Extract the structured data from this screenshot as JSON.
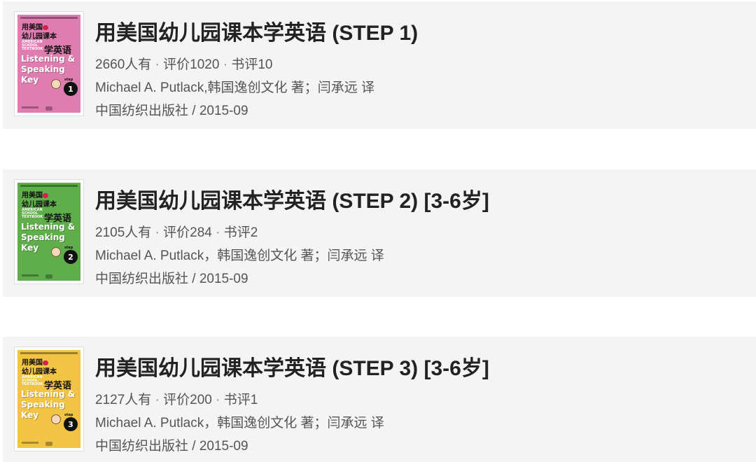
{
  "books": [
    {
      "title": "用美国幼儿园课本学英语 (STEP 1)",
      "owners": "2660人有",
      "ratings": "评价1020",
      "reviews": "书评10",
      "separator": " · ",
      "authors": "Michael A. Putlack,韩国逸创文化 著；闫承远 译",
      "publisher": "中国纺织出版社 / 2015-09",
      "cover": {
        "color": "#e07db0",
        "title_line1": "用美国",
        "title_line2": "幼儿园课本",
        "subtitle": "学英语",
        "school_text": "AMERICAN SCHOOL TEXTBOOK",
        "series_name": "Listening &\nSpeaking\nKey",
        "step_label": "step",
        "step_number": "1"
      }
    },
    {
      "title": "用美国幼儿园课本学英语 (STEP 2) [3-6岁]",
      "owners": "2105人有",
      "ratings": "评价284",
      "reviews": "书评2",
      "separator": " · ",
      "authors": "Michael A. Putlack，韩国逸创文化 著；闫承远 译",
      "publisher": "中国纺织出版社 / 2015-09",
      "cover": {
        "color": "#5fae4b",
        "title_line1": "用美国",
        "title_line2": "幼儿园课本",
        "subtitle": "学英语",
        "school_text": "AMERICAN SCHOOL TEXTBOOK",
        "series_name": "Listening &\nSpeaking\nKey",
        "step_label": "step",
        "step_number": "2"
      }
    },
    {
      "title": "用美国幼儿园课本学英语 (STEP 3) [3-6岁]",
      "owners": "2127人有",
      "ratings": "评价200",
      "reviews": "书评1",
      "separator": " · ",
      "authors": "Michael A. Putlack，韩国逸创文化 著；闫承远 译",
      "publisher": "中国纺织出版社 / 2015-09",
      "cover": {
        "color": "#f2c443",
        "title_line1": "用美国",
        "title_line2": "幼儿园课本",
        "subtitle": "学英语",
        "school_text": "AMERICAN SCHOOL TEXTBOOK",
        "series_name": "Listening &\nSpeaking\nKey",
        "step_label": "step",
        "step_number": "3"
      }
    }
  ]
}
